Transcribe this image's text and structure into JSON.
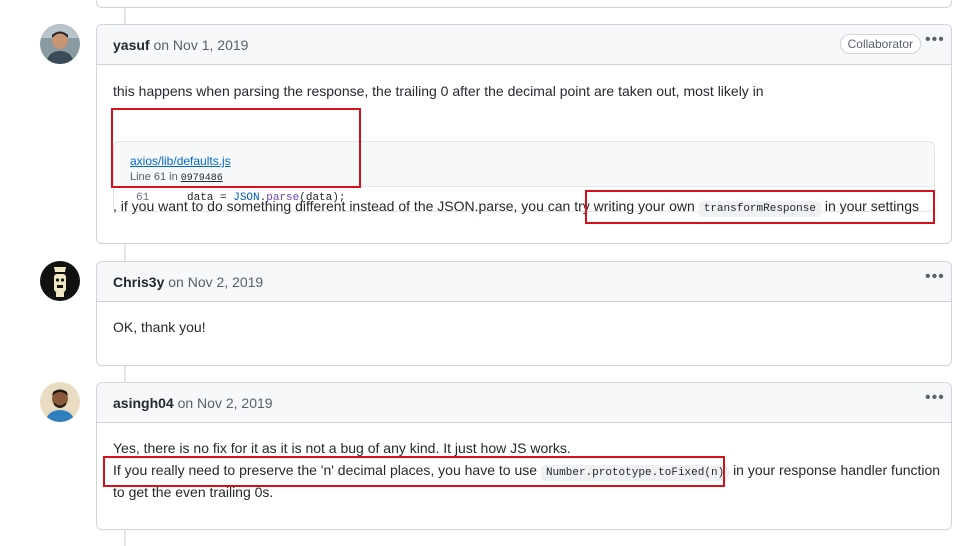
{
  "comments": [
    {
      "author": "yasuf",
      "date": "on Nov 1, 2019",
      "badge": "Collaborator",
      "more_icon": "kebab-horizontal-icon",
      "body_text_1": "this happens when parsing the response, the trailing 0 after the decimal point are taken out, most likely in",
      "snippet": {
        "file_link": "axios/lib/defaults.js",
        "line_prefix": "Line 61 in",
        "commit_sha": "0979486",
        "line_number": "61",
        "code_prefix": "data = ",
        "code_obj": "JSON",
        "code_dot": ".",
        "code_method": "parse",
        "code_args": "(data);"
      },
      "body_text_2": ", if you want to do something different instead of the JSON.parse, you can try writing your own",
      "inline_code": "transformResponse",
      "body_text_3": "in your settings"
    },
    {
      "author": "Chris3y",
      "date": "on Nov 2, 2019",
      "more_icon": "kebab-horizontal-icon",
      "body_text": "OK, thank you!"
    },
    {
      "author": "asingh04",
      "date": "on Nov 2, 2019",
      "more_icon": "kebab-horizontal-icon",
      "body_line_1": "Yes, there is no fix for it as it is not a bug of any kind. It just how JS works.",
      "body_line_2_a": "If you really need to preserve the 'n' decimal places, you have to use",
      "inline_code": "Number.prototype.toFixed(n)",
      "body_line_2_b": "in your response handler function",
      "body_line_3": "to get the even trailing 0s."
    }
  ],
  "colors": {
    "highlight": "#d8101c",
    "link": "#0366d6",
    "border": "#d1d5da",
    "header_bg": "#f6f8fa"
  }
}
